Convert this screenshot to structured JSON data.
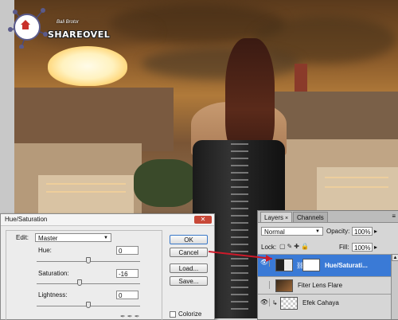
{
  "logo": {
    "name": "SHAREOVEL",
    "tagline": "Bali Brotor"
  },
  "hue_saturation": {
    "title": "Hue/Saturation",
    "edit_label": "Edit:",
    "edit_value": "Master",
    "hue_label": "Hue:",
    "hue_value": "0",
    "saturation_label": "Saturation:",
    "saturation_value": "-16",
    "lightness_label": "Lightness:",
    "lightness_value": "0",
    "ok_label": "OK",
    "cancel_label": "Cancel",
    "load_label": "Load...",
    "save_label": "Save...",
    "colorize_label": "Colorize",
    "colorize_checked": false,
    "close_icon": "close-icon"
  },
  "layers_panel": {
    "tabs": [
      {
        "label": "Layers",
        "close": "×"
      },
      {
        "label": "Channels"
      }
    ],
    "menu_icon": "≡",
    "blend_mode": "Normal",
    "opacity_label": "Opacity:",
    "opacity_value": "100%",
    "lock_label": "Lock:",
    "fill_label": "Fill:",
    "fill_value": "100%",
    "layers": [
      {
        "name": "Hue/Saturati...",
        "selected": true,
        "visible": true
      },
      {
        "name": "Fiter Lens Flare",
        "selected": false,
        "visible": false
      },
      {
        "name": "Efek Cahaya",
        "selected": false,
        "visible": true
      }
    ]
  },
  "colors": {
    "selection": "#3a7ad6",
    "close_button": "#c84838",
    "annotation_arrow": "#cc1a2a"
  }
}
